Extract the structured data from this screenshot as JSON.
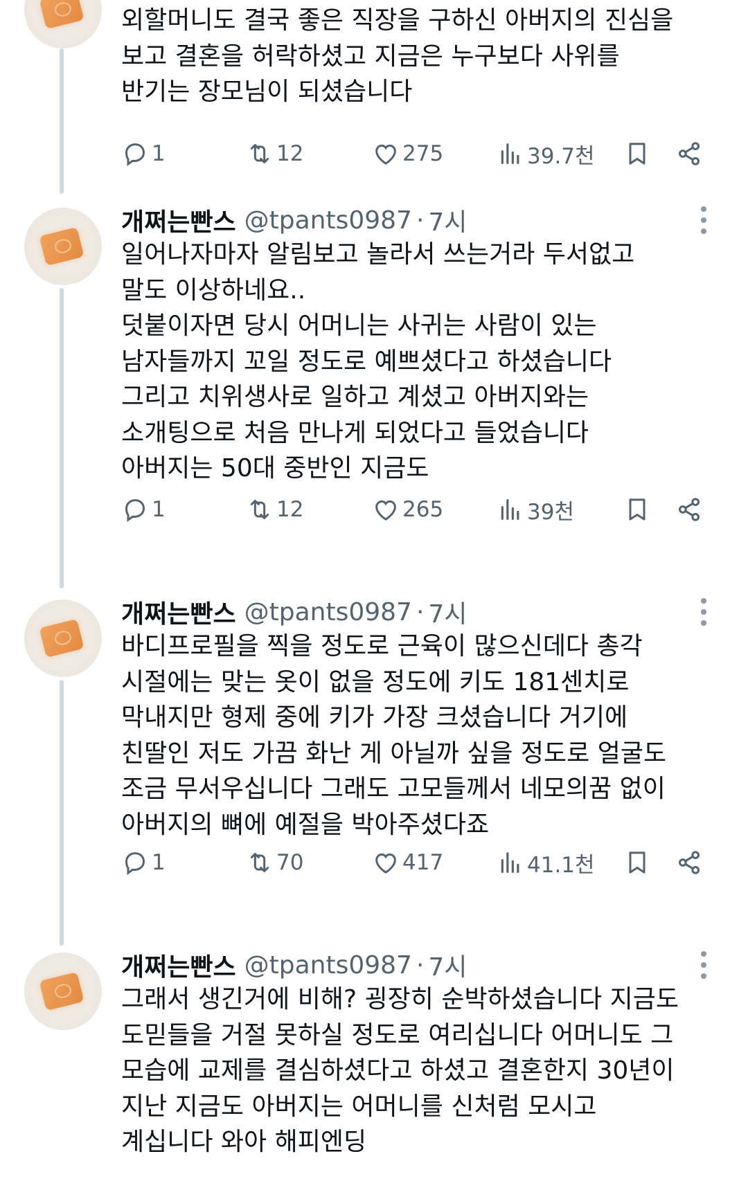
{
  "tweets": [
    {
      "show_header": false,
      "name": "",
      "handle": "",
      "separator": "",
      "time": "",
      "text": "외할머니도 결국 좋은 직장을 구하신 아버지의 진심을\n보고 결혼을 허락하셨고 지금은 누구보다 사위를\n반기는 장모님이 되셨습니다",
      "replies": "1",
      "retweets": "12",
      "likes": "275",
      "views": "39.7천"
    },
    {
      "show_header": true,
      "name": "개쩌는빤스",
      "handle": "@tpants0987",
      "separator": "·",
      "time": "7시",
      "text": "일어나자마자 알림보고 놀라서 쓰는거라 두서없고\n말도 이상하네요..\n덧붙이자면 당시 어머니는 사귀는 사람이 있는\n남자들까지 꼬일 정도로 예쁘셨다고 하셨습니다\n그리고 치위생사로 일하고 계셨고 아버지와는\n소개팅으로 처음 만나게 되었다고 들었습니다\n아버지는 50대 중반인 지금도",
      "replies": "1",
      "retweets": "12",
      "likes": "265",
      "views": "39천"
    },
    {
      "show_header": true,
      "name": "개쩌는빤스",
      "handle": "@tpants0987",
      "separator": "·",
      "time": "7시",
      "text": "바디프로필을 찍을 정도로 근육이 많으신데다 총각\n시절에는 맞는 옷이 없을 정도에 키도 181센치로\n막내지만 형제 중에 키가 가장 크셨습니다 거기에\n친딸인 저도 가끔 화난 게 아닐까 싶을 정도로 얼굴도\n조금 무서우십니다 그래도 고모들께서 네모의꿈 없이\n아버지의 뼈에 예절을 박아주셨다죠",
      "replies": "1",
      "retweets": "70",
      "likes": "417",
      "views": "41.1천"
    },
    {
      "show_header": true,
      "name": "개쩌는빤스",
      "handle": "@tpants0987",
      "separator": "·",
      "time": "7시",
      "text": "그래서 생긴거에 비해? 굉장히 순박하셨습니다 지금도\n도믿들을 거절 못하실 정도로 여리십니다 어머니도 그\n모습에 교제를 결심하셨다고 하셨고 결혼한지 30년이\n지난 지금도 아버지는 어머니를 신처럼 모시고\n계십니다 와아 해피엔딩",
      "replies": "",
      "retweets": "",
      "likes": "",
      "views": ""
    }
  ],
  "colors": {
    "text": "#0f1419",
    "secondary": "#536471",
    "thread_line": "#cfd9de",
    "avatar_accent": "#e8914a"
  },
  "icons": [
    "reply-icon",
    "retweet-icon",
    "like-icon",
    "views-icon",
    "bookmark-icon",
    "share-icon",
    "more-icon"
  ]
}
